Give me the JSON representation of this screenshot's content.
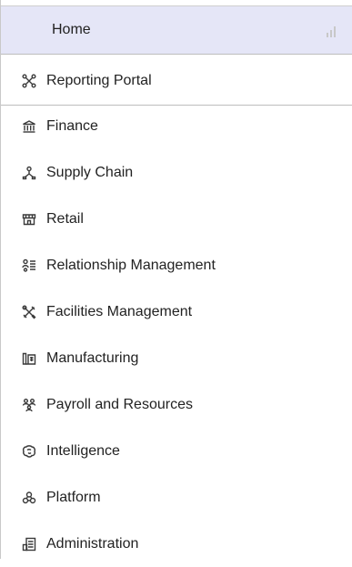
{
  "home": {
    "label": "Home",
    "icon": "bar-chart-icon"
  },
  "items": [
    {
      "label": "Reporting Portal",
      "icon": "reporting-icon"
    },
    {
      "label": "Finance",
      "icon": "bank-icon"
    },
    {
      "label": "Supply Chain",
      "icon": "supply-chain-icon"
    },
    {
      "label": "Retail",
      "icon": "storefront-icon"
    },
    {
      "label": "Relationship Management",
      "icon": "people-list-icon"
    },
    {
      "label": "Facilities Management",
      "icon": "tools-icon"
    },
    {
      "label": "Manufacturing",
      "icon": "factory-icon"
    },
    {
      "label": "Payroll and Resources",
      "icon": "group-icon"
    },
    {
      "label": "Intelligence",
      "icon": "brain-icon"
    },
    {
      "label": "Platform",
      "icon": "platform-icon"
    },
    {
      "label": "Administration",
      "icon": "admin-icon"
    }
  ]
}
